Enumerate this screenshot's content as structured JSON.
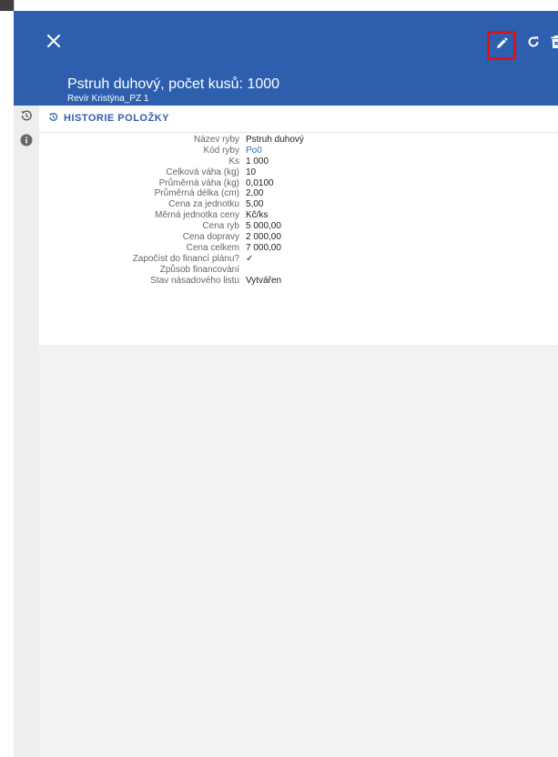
{
  "header": {
    "title": "Pstruh duhový, počet kusů: 1000",
    "subtitle": "Revír Kristýna_PZ 1"
  },
  "section": {
    "title": "HISTORIE POLOŽKY"
  },
  "details": [
    {
      "label": "Název ryby",
      "value": "Pstruh duhový"
    },
    {
      "label": "Kód ryby",
      "value": "Po0"
    },
    {
      "label": "Ks",
      "value": "1 000"
    },
    {
      "label": "Celková váha (kg)",
      "value": "10"
    },
    {
      "label": "Průměrná váha (kg)",
      "value": "0,0100"
    },
    {
      "label": "Průměrná délka (cm)",
      "value": "2,00"
    },
    {
      "label": "Cena za jednotku",
      "value": "5,00"
    },
    {
      "label": "Měrná jednotka ceny",
      "value": "Kč/ks"
    },
    {
      "label": "Cena ryb",
      "value": "5 000,00"
    },
    {
      "label": "Cena dopravy",
      "value": "2 000,00"
    },
    {
      "label": "Cena celkem",
      "value": "7 000,00"
    },
    {
      "label": "Započíst do financí plánu?",
      "value": "✓"
    },
    {
      "label": "Způsob financování",
      "value": ""
    },
    {
      "label": "Stav násadového listu",
      "value": "Vytvářen"
    }
  ],
  "icons": {
    "close": "close-icon",
    "edit": "pencil-icon",
    "refresh": "refresh-icon",
    "delete": "trash-icon",
    "history": "history-icon",
    "info": "info-icon"
  },
  "colors": {
    "header_bg": "#2d5fae",
    "accent": "#2d5fae",
    "highlight": "#e0101a",
    "link": "#2f6fc2"
  }
}
